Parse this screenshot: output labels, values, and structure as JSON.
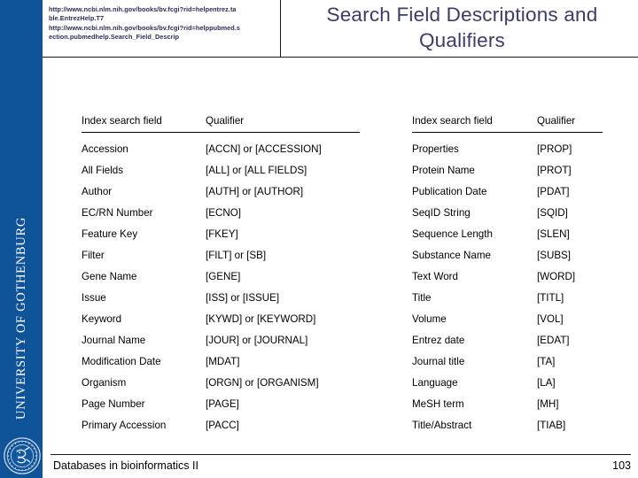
{
  "slide": {
    "title": "Search Field Descriptions and Qualifiers",
    "title_line1": "Search Field Descriptions and",
    "title_line2": "Qualifiers",
    "accent_blue": "#0f5499",
    "title_color": "#3b3b6d"
  },
  "sidebar": {
    "vertical_text": "UNIVERSITY OF GOTHENBURG",
    "seal_name": "university-seal"
  },
  "source_urls": {
    "url1": "http://www.ncbi.nlm.nih.gov/books/bv.fcgi?rid=helpentrez.table.EntrezHelp.T7",
    "url2": "http://www.ncbi.nlm.nih.gov/books/bv.fcgi?rid=helppubmed.section.pubmedhelp.Search_Field_Descrip"
  },
  "table_left": {
    "headers": [
      "Index search field",
      "Qualifier"
    ],
    "rows": [
      [
        "Accession",
        "[ACCN] or [ACCESSION]"
      ],
      [
        "All Fields",
        "[ALL] or [ALL FIELDS]"
      ],
      [
        "Author",
        "[AUTH] or [AUTHOR]"
      ],
      [
        "EC/RN Number",
        "[ECNO]"
      ],
      [
        "Feature Key",
        "[FKEY]"
      ],
      [
        "Filter",
        "[FILT] or [SB]"
      ],
      [
        "Gene Name",
        "[GENE]"
      ],
      [
        "Issue",
        "[ISS] or [ISSUE]"
      ],
      [
        "Keyword",
        "[KYWD] or [KEYWORD]"
      ],
      [
        "Journal Name",
        "[JOUR] or [JOURNAL]"
      ],
      [
        "Modification Date",
        "[MDAT]"
      ],
      [
        "Organism",
        "[ORGN] or [ORGANISM]"
      ],
      [
        "Page Number",
        "[PAGE]"
      ],
      [
        "Primary Accession",
        "[PACC]"
      ]
    ]
  },
  "table_right": {
    "headers": [
      "Index search field",
      "Qualifier"
    ],
    "rows": [
      [
        "Properties",
        "[PROP]"
      ],
      [
        "Protein Name",
        "[PROT]"
      ],
      [
        "Publication Date",
        "[PDAT]"
      ],
      [
        "SeqID String",
        "[SQID]"
      ],
      [
        "Sequence Length",
        "[SLEN]"
      ],
      [
        "Substance Name",
        "[SUBS]"
      ],
      [
        "Text Word",
        "[WORD]"
      ],
      [
        "Title",
        "[TITL]"
      ],
      [
        "Volume",
        "[VOL]"
      ],
      [
        "Entrez date",
        "[EDAT]"
      ],
      [
        "Journal title",
        "[TA]"
      ],
      [
        "Language",
        "[LA]"
      ],
      [
        "MeSH term",
        "[MH]"
      ],
      [
        "Title/Abstract",
        "[TIAB]"
      ]
    ]
  },
  "footer": {
    "course": "Databases in bioinformatics II",
    "page_number": "103"
  }
}
